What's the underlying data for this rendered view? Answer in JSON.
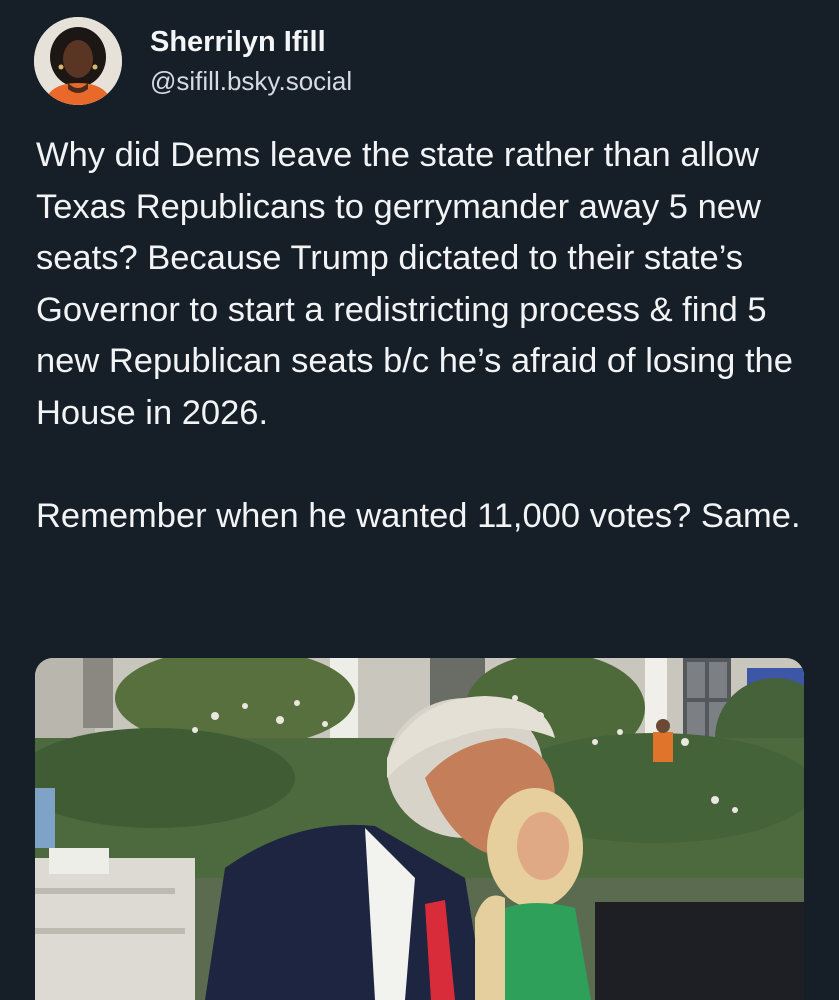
{
  "post": {
    "author": {
      "display_name": "Sherrilyn Ifill",
      "handle": "@sifill.bsky.social",
      "avatar_icon": "avatar-photo"
    },
    "body": {
      "paragraphs": [
        "Why did Dems leave the state rather than allow Texas Republicans to gerrymander away 5 new seats? Because Trump dictated to their state’s Governor to start a redistricting process & find 5 new Republican seats b/c he’s afraid of losing the House in 2026.",
        "Remember when he wanted 11,000 votes? Same."
      ]
    },
    "media": {
      "type": "photo"
    }
  },
  "colors": {
    "background": "#161e27",
    "text": "#f1f3f5",
    "handle": "#d5dbe2"
  }
}
